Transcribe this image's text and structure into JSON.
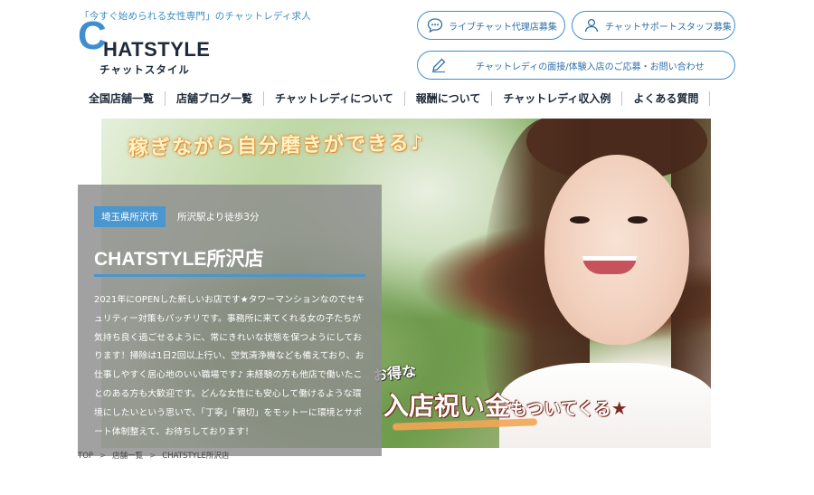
{
  "header": {
    "tagline": "「今すぐ始められる女性専門」のチャットレディ求人",
    "logo_c": "C",
    "logo_rest": "HATSTYLE",
    "logo_kana": "チャットスタイル",
    "buttons": {
      "agency": "ライブチャット代理店募集",
      "staff": "チャットサポートスタッフ募集",
      "contact": "チャットレディの面接/体験入店のご応募・お問い合わせ"
    }
  },
  "nav": {
    "items": [
      "全国店舗一覧",
      "店舗ブログ一覧",
      "チャットレディについて",
      "報酬について",
      "チャットレディ収入例",
      "よくある質問"
    ]
  },
  "hero": {
    "top_text": "稼ぎながら自分磨きができる♪",
    "bonus_small": "お得な",
    "bonus_main": "入店祝い金",
    "bonus_sub": "もついてくる",
    "bonus_star": "★"
  },
  "shop": {
    "area": "埼玉県所沢市",
    "station": "所沢駅より徒歩3分",
    "name": "CHATSTYLE所沢店",
    "description": "2021年にOPENした新しいお店です★タワーマンションなのでセキュリティー対策もバッチリです。事務所に来てくれる女の子たちが気持ち良く過ごせるように、常にきれいな状態を保つようにしております！掃除は1日2回以上行い、空気清浄機なども備えており、お仕事しやすく居心地のいい職場です♪ 未経験の方も他店で働いたことのある方も大歓迎です。どんな女性にも安心して働けるような環境にしたいという思いで、「丁寧」「親切」をモットーに環境とサポート体制整えて、お待ちしております！"
  },
  "breadcrumb": {
    "items": [
      "TOP",
      "店舗一覧",
      "CHATSTYLE所沢店"
    ],
    "separator": ">"
  },
  "colors": {
    "brand": "#3f8fd0",
    "navy": "#1d2a3a",
    "overlay": "#8c8c8c"
  }
}
